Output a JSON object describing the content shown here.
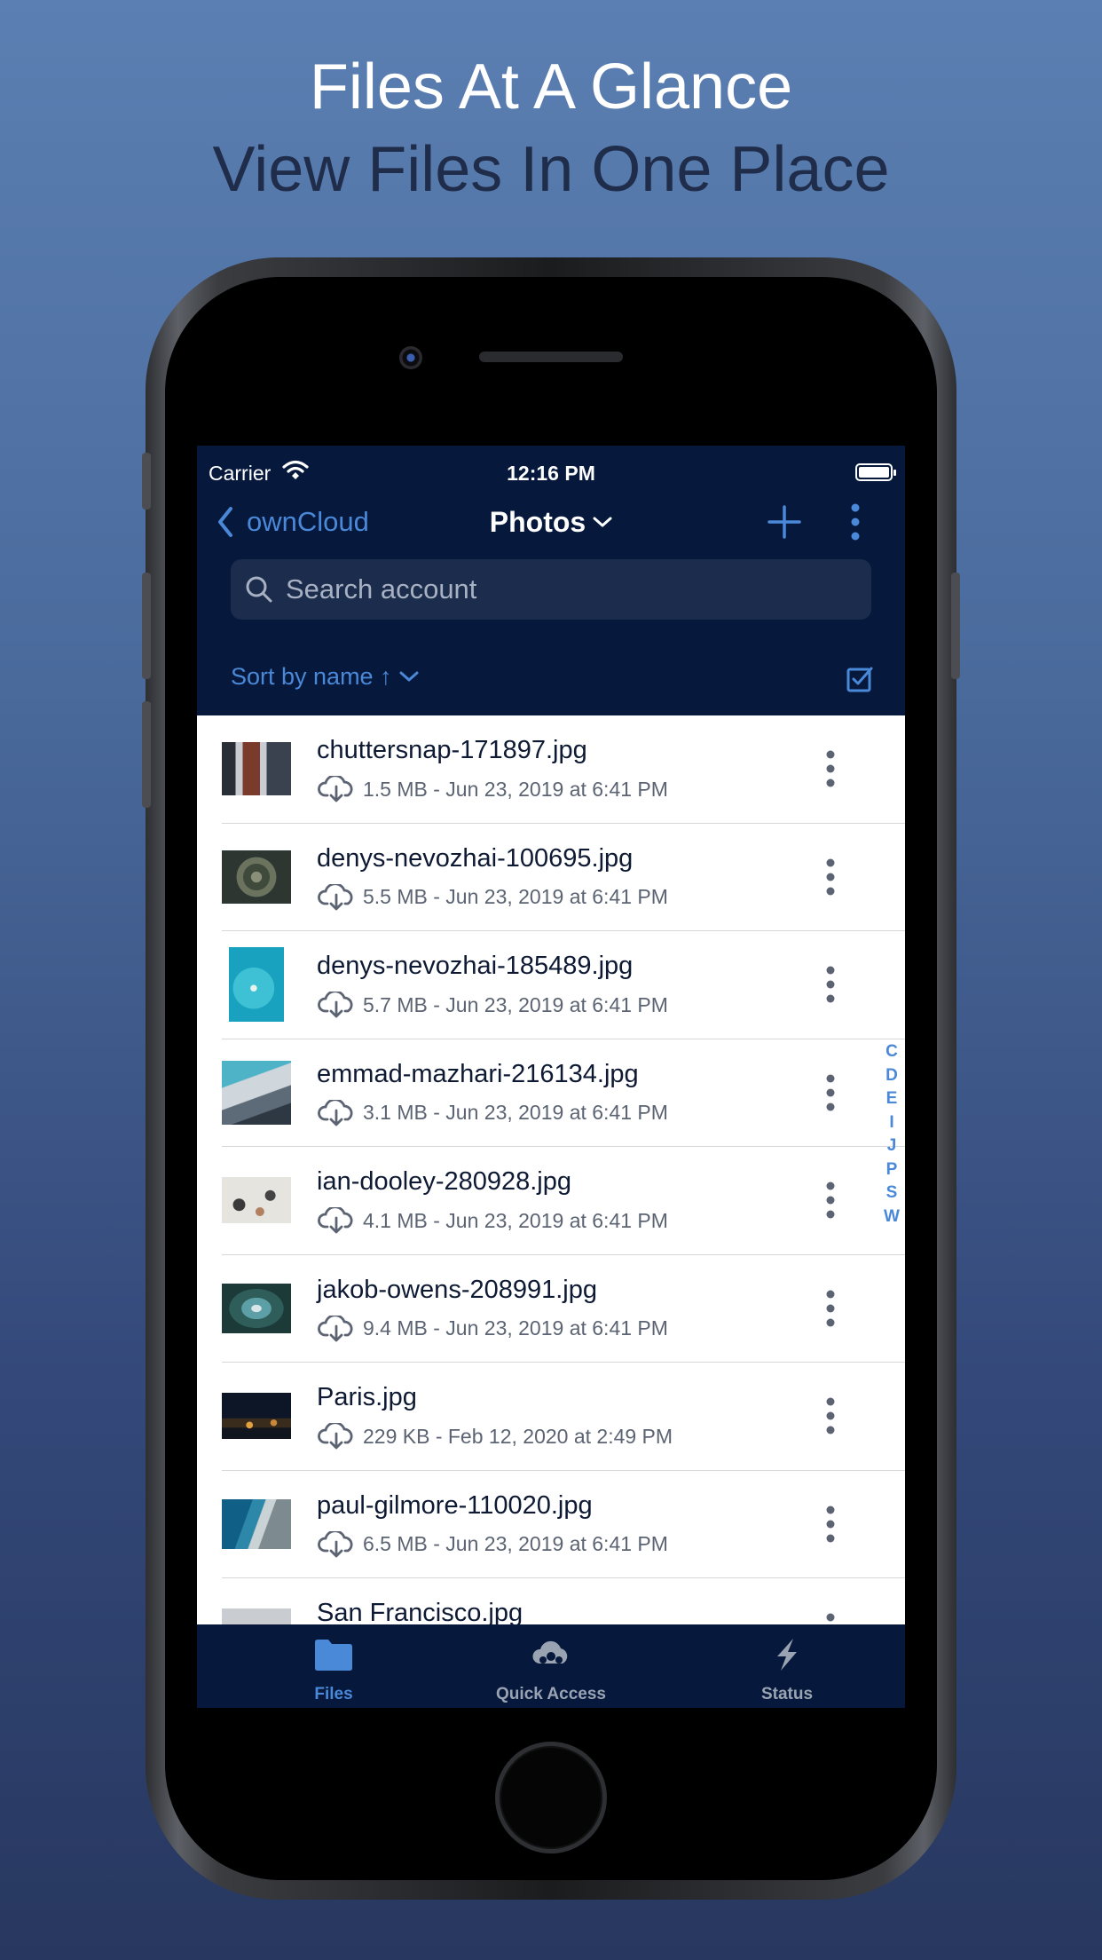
{
  "headline": {
    "line1": "Files At A Glance",
    "line2": "View Files In One Place"
  },
  "status_bar": {
    "carrier": "Carrier",
    "time": "12:16 PM"
  },
  "nav": {
    "back_label": "ownCloud",
    "title": "Photos"
  },
  "search": {
    "placeholder": "Search account"
  },
  "sort": {
    "label": "Sort by name ↑"
  },
  "files": [
    {
      "name": "chuttersnap-171897.jpg",
      "meta": "1.5 MB - Jun 23, 2019 at 6:41 PM"
    },
    {
      "name": "denys-nevozhai-100695.jpg",
      "meta": "5.5 MB - Jun 23, 2019 at 6:41 PM"
    },
    {
      "name": "denys-nevozhai-185489.jpg",
      "meta": "5.7 MB - Jun 23, 2019 at 6:41 PM"
    },
    {
      "name": "emmad-mazhari-216134.jpg",
      "meta": "3.1 MB - Jun 23, 2019 at 6:41 PM"
    },
    {
      "name": "ian-dooley-280928.jpg",
      "meta": "4.1 MB - Jun 23, 2019 at 6:41 PM"
    },
    {
      "name": "jakob-owens-208991.jpg",
      "meta": "9.4 MB - Jun 23, 2019 at 6:41 PM"
    },
    {
      "name": "Paris.jpg",
      "meta": "229 KB - Feb 12, 2020 at 2:49 PM"
    },
    {
      "name": "paul-gilmore-110020.jpg",
      "meta": "6.5 MB - Jun 23, 2019 at 6:41 PM"
    },
    {
      "name": "San Francisco.jpg",
      "meta": ""
    }
  ],
  "section_index": [
    "C",
    "D",
    "E",
    "I",
    "J",
    "P",
    "S",
    "W"
  ],
  "tabs": {
    "files": "Files",
    "quick_access": "Quick Access",
    "status": "Status"
  },
  "colors": {
    "accent": "#4a88d8",
    "nav_background": "#06183c"
  }
}
